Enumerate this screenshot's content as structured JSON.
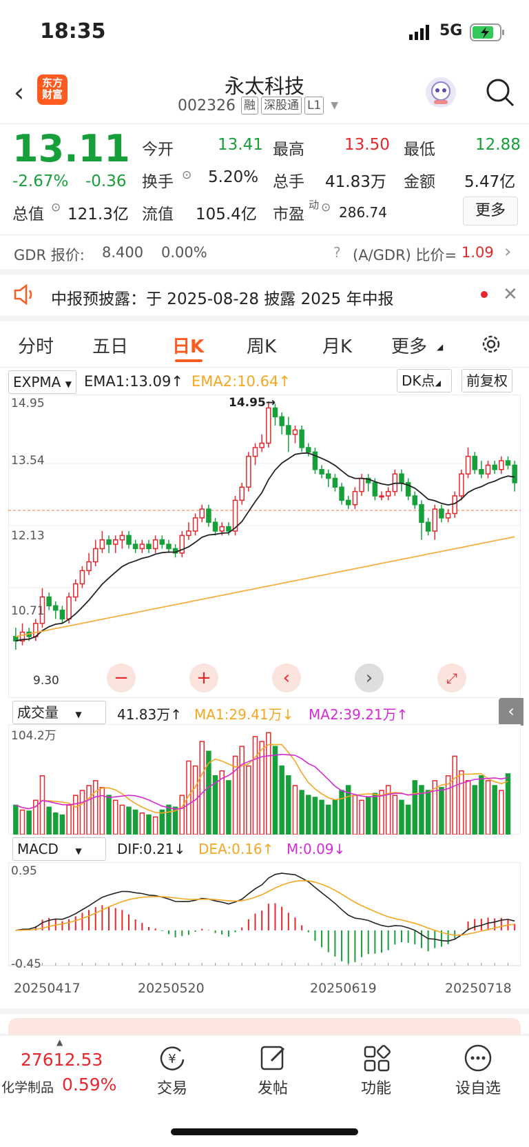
{
  "status": {
    "time": "18:35",
    "network": "5G"
  },
  "header": {
    "logo_line1": "东方",
    "logo_line2": "财富",
    "title": "永太科技",
    "code": "002326",
    "badges": [
      "融",
      "深股通",
      "L1"
    ]
  },
  "quote": {
    "price": "13.11",
    "change_pct": "-2.67%",
    "change": "-0.36",
    "open_label": "今开",
    "open": "13.41",
    "high_label": "最高",
    "high": "13.50",
    "low_label": "最低",
    "low": "12.88",
    "turnover_label": "换手",
    "turnover": "5.20%",
    "volume_label": "总手",
    "volume": "41.83万",
    "amount_label": "金额",
    "amount": "5.47亿",
    "mcap_label": "总值",
    "mcap": "121.3亿",
    "float_label": "流值",
    "float": "105.4亿",
    "pe_label": "市盈",
    "pe_sup": "动",
    "pe": "286.74",
    "more_label": "更多"
  },
  "gdr": {
    "label": "GDR 报价:",
    "price": "8.400",
    "pct": "0.00%",
    "ratio_label": "(A/GDR) 比价=",
    "ratio": "1.09"
  },
  "notice": {
    "text": "中报预披露：于 2025-08-28 披露 2025 年中报"
  },
  "tabs": [
    "分时",
    "五日",
    "日K",
    "周K",
    "月K",
    "更多"
  ],
  "kline": {
    "indicator": "EXPMA",
    "ema1": "EMA1:13.09",
    "ema2": "EMA2:10.64",
    "dk_label": "DK点",
    "adjust_label": "前复权",
    "y_labels": [
      "14.95",
      "13.54",
      "12.13",
      "10.71",
      "9.30"
    ],
    "high_marker": "14.95",
    "low_marker": "9.30",
    "colors": {
      "up": "#e8262c",
      "down": "#17a03a",
      "ema1": "#222222",
      "ema2": "#f5b040"
    },
    "close_line": "12.47"
  },
  "volume": {
    "indicator": "成交量",
    "vol": "41.83万",
    "ma1": "MA1:29.41万",
    "ma2": "MA2:39.21万",
    "max_label": "104.2万"
  },
  "macd": {
    "indicator": "MACD",
    "dif": "DIF:0.21",
    "dea": "DEA:0.16",
    "m": "M:0.09",
    "max_label": "0.95",
    "min_label": "-0.45"
  },
  "dates": [
    "20250417",
    "20250520",
    "20250619",
    "20250718"
  ],
  "bottom": {
    "index_value": "27612.53",
    "index_name": "化学制品",
    "index_pct": "0.59%",
    "items": [
      "交易",
      "发帖",
      "功能",
      "设自选"
    ]
  },
  "chart_data": {
    "type": "candlestick",
    "ylim": [
      9.3,
      14.95
    ],
    "candles": [
      [
        9.6,
        9.5,
        9.8,
        9.3
      ],
      [
        9.5,
        9.7,
        9.9,
        9.4
      ],
      [
        9.7,
        9.6,
        9.8,
        9.5
      ],
      [
        9.6,
        9.9,
        10.0,
        9.5
      ],
      [
        9.9,
        10.5,
        10.7,
        9.8
      ],
      [
        10.5,
        10.3,
        10.6,
        10.2
      ],
      [
        10.3,
        10.2,
        10.4,
        10.0
      ],
      [
        10.2,
        10.0,
        10.3,
        9.9
      ],
      [
        10.0,
        10.5,
        10.6,
        9.9
      ],
      [
        10.5,
        10.8,
        10.9,
        10.4
      ],
      [
        10.8,
        11.1,
        11.2,
        10.7
      ],
      [
        11.1,
        11.3,
        11.5,
        11.0
      ],
      [
        11.3,
        11.6,
        11.8,
        11.2
      ],
      [
        11.6,
        11.8,
        12.0,
        11.5
      ],
      [
        11.8,
        11.7,
        11.9,
        11.5
      ],
      [
        11.7,
        11.8,
        11.9,
        11.5
      ],
      [
        11.8,
        11.9,
        12.0,
        11.6
      ],
      [
        11.9,
        11.7,
        12.0,
        11.6
      ],
      [
        11.7,
        11.6,
        11.8,
        11.5
      ],
      [
        11.6,
        11.7,
        11.8,
        11.5
      ],
      [
        11.7,
        11.6,
        11.8,
        11.5
      ],
      [
        11.6,
        11.8,
        11.9,
        11.5
      ],
      [
        11.8,
        11.7,
        11.9,
        11.6
      ],
      [
        11.7,
        11.6,
        11.8,
        11.5
      ],
      [
        11.6,
        11.5,
        11.7,
        11.4
      ],
      [
        11.5,
        11.9,
        12.0,
        11.4
      ],
      [
        11.9,
        12.0,
        12.2,
        11.8
      ],
      [
        12.0,
        12.3,
        12.4,
        11.9
      ],
      [
        12.3,
        12.5,
        12.6,
        12.2
      ],
      [
        12.5,
        12.2,
        12.6,
        12.1
      ],
      [
        12.2,
        12.0,
        12.3,
        11.9
      ],
      [
        12.0,
        12.1,
        12.2,
        11.9
      ],
      [
        12.1,
        12.0,
        12.2,
        11.9
      ],
      [
        12.0,
        12.7,
        12.8,
        11.9
      ],
      [
        12.7,
        13.0,
        13.1,
        12.6
      ],
      [
        13.0,
        13.7,
        13.8,
        12.9
      ],
      [
        13.7,
        13.9,
        14.0,
        13.5
      ],
      [
        13.9,
        14.0,
        14.2,
        13.8
      ],
      [
        14.0,
        14.8,
        14.95,
        13.9
      ],
      [
        14.8,
        14.6,
        14.9,
        14.4
      ],
      [
        14.6,
        14.4,
        14.7,
        14.2
      ],
      [
        14.4,
        14.2,
        14.6,
        13.8
      ],
      [
        14.2,
        14.3,
        14.4,
        14.0
      ],
      [
        14.3,
        13.9,
        14.4,
        13.8
      ],
      [
        13.9,
        13.8,
        14.0,
        13.7
      ],
      [
        13.8,
        13.4,
        13.9,
        13.3
      ],
      [
        13.4,
        13.3,
        13.5,
        13.2
      ],
      [
        13.3,
        13.2,
        13.4,
        13.0
      ],
      [
        13.2,
        13.0,
        13.3,
        12.9
      ],
      [
        13.0,
        12.7,
        13.1,
        12.6
      ],
      [
        12.7,
        12.6,
        12.8,
        12.5
      ],
      [
        12.6,
        12.9,
        13.0,
        12.5
      ],
      [
        12.9,
        13.2,
        13.3,
        12.8
      ],
      [
        13.2,
        13.1,
        13.3,
        12.9
      ],
      [
        13.1,
        12.8,
        13.2,
        12.7
      ],
      [
        12.8,
        12.8,
        12.9,
        12.7
      ],
      [
        12.8,
        12.9,
        13.0,
        12.7
      ],
      [
        12.9,
        13.3,
        13.4,
        12.8
      ],
      [
        13.3,
        13.1,
        13.4,
        12.9
      ],
      [
        13.1,
        12.8,
        13.2,
        12.7
      ],
      [
        12.8,
        12.6,
        12.9,
        12.5
      ],
      [
        12.6,
        12.2,
        12.7,
        11.8
      ],
      [
        12.2,
        12.0,
        12.3,
        11.9
      ],
      [
        12.0,
        12.5,
        12.6,
        11.8
      ],
      [
        12.5,
        12.3,
        12.6,
        12.2
      ],
      [
        12.3,
        12.4,
        12.5,
        12.2
      ],
      [
        12.4,
        12.8,
        12.9,
        12.3
      ],
      [
        12.8,
        13.3,
        13.4,
        12.7
      ],
      [
        13.3,
        13.7,
        13.9,
        13.2
      ],
      [
        13.7,
        13.4,
        13.8,
        13.3
      ],
      [
        13.4,
        13.3,
        13.6,
        13.2
      ],
      [
        13.3,
        13.5,
        13.6,
        13.2
      ],
      [
        13.5,
        13.4,
        13.6,
        13.3
      ],
      [
        13.4,
        13.6,
        13.7,
        13.3
      ],
      [
        13.6,
        13.5,
        13.7,
        13.4
      ],
      [
        13.5,
        13.1,
        13.6,
        12.9
      ]
    ],
    "volume_values": [
      30,
      25,
      24,
      35,
      60,
      28,
      22,
      20,
      30,
      40,
      45,
      50,
      55,
      48,
      40,
      35,
      30,
      28,
      25,
      22,
      20,
      18,
      25,
      30,
      28,
      40,
      75,
      70,
      95,
      85,
      60,
      65,
      55,
      80,
      90,
      70,
      100,
      95,
      104,
      90,
      70,
      60,
      50,
      45,
      40,
      38,
      35,
      30,
      35,
      45,
      50,
      40,
      35,
      38,
      42,
      45,
      50,
      40,
      35,
      30,
      55,
      50,
      45,
      55,
      48,
      60,
      80,
      65,
      55,
      50,
      60,
      55,
      50,
      45,
      62
    ]
  }
}
